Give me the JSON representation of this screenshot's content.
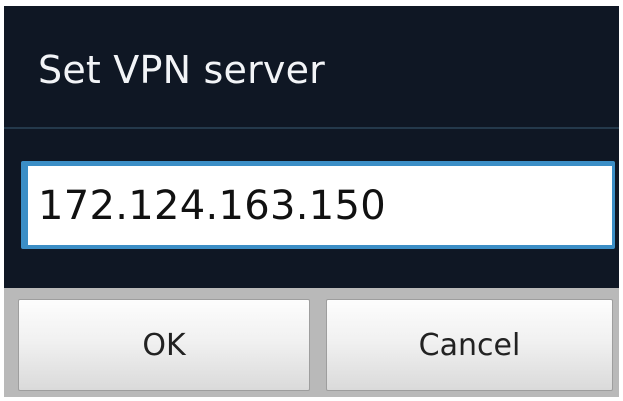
{
  "dialog": {
    "title": "Set VPN server",
    "server_input": {
      "value": "172.124.163.150",
      "placeholder": ""
    },
    "buttons": {
      "ok_label": "OK",
      "cancel_label": "Cancel"
    }
  },
  "colors": {
    "dialog_background": "#0f1724",
    "input_focus_border": "#3b8ec6",
    "button_bar_background": "#b9b9b9"
  }
}
